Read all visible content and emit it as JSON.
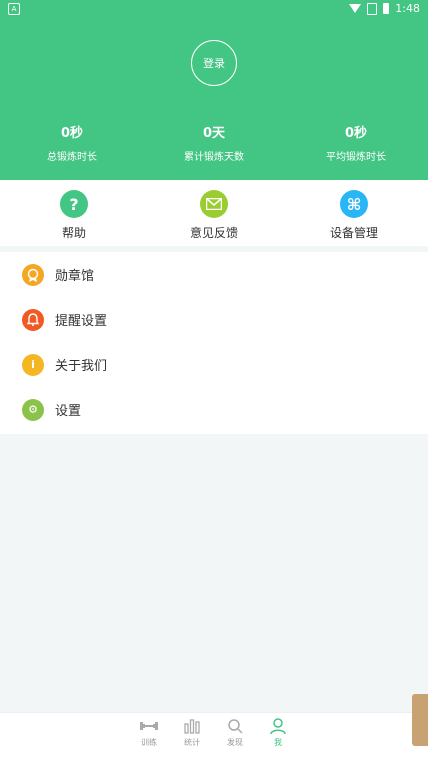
{
  "status_bar": {
    "time": "1:48"
  },
  "header": {
    "login_label": "登录",
    "stats": [
      {
        "value": "0秒",
        "label": "总锻炼时长"
      },
      {
        "value": "0天",
        "label": "累计锻炼天数"
      },
      {
        "value": "0秒",
        "label": "平均锻炼时长"
      }
    ],
    "bg_color": "#43c584"
  },
  "quick_actions": [
    {
      "label": "帮助",
      "icon": "help-icon",
      "color": "#43c584"
    },
    {
      "label": "意见反馈",
      "icon": "mail-icon",
      "color": "#9acd32"
    },
    {
      "label": "设备管理",
      "icon": "command-icon",
      "color": "#29b6f6"
    }
  ],
  "menu": [
    {
      "label": "勋章馆",
      "icon": "medal-icon",
      "color": "#f5a623"
    },
    {
      "label": "提醒设置",
      "icon": "bell-icon",
      "color": "#f15a24"
    },
    {
      "label": "关于我们",
      "icon": "info-icon",
      "color": "#f5b623"
    },
    {
      "label": "设置",
      "icon": "gear-icon",
      "color": "#8bc34a"
    }
  ],
  "tabs": [
    {
      "label": "训练",
      "icon": "dumbbell-icon",
      "active": false
    },
    {
      "label": "统计",
      "icon": "bar-chart-icon",
      "active": false
    },
    {
      "label": "发现",
      "icon": "search-icon",
      "active": false
    },
    {
      "label": "我",
      "icon": "person-icon",
      "active": true
    }
  ]
}
